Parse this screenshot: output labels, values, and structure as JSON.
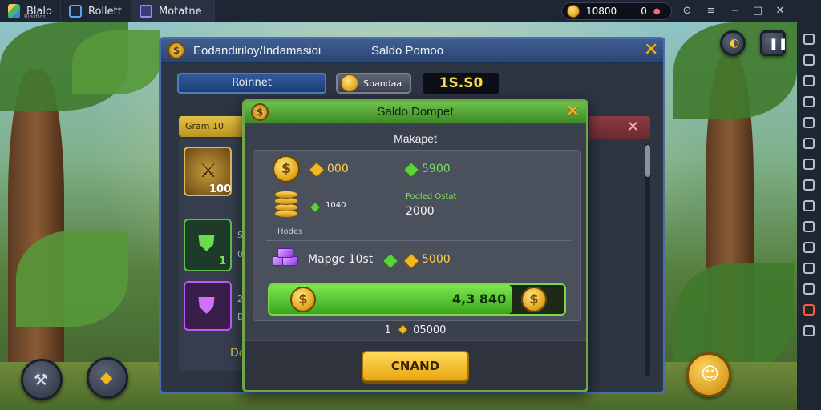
{
  "window": {
    "app_title": "Blalo",
    "app_subtitle": "Blastics",
    "tabs": [
      {
        "label": "Rollett",
        "icon": "app-icon"
      },
      {
        "label": "Motatne",
        "icon": "game-icon"
      }
    ],
    "coin_balance": "10800",
    "coin_secondary": "0",
    "controls": [
      "record-icon",
      "settings-icon",
      "menu-icon",
      "minimize-icon",
      "maximize-icon",
      "close-icon"
    ]
  },
  "sidebar": {
    "icons": [
      "expand-icon",
      "keyboard-icon",
      "volume-icon",
      "screen-icon",
      "camera-icon",
      "record-icon",
      "folder-icon",
      "multi-instance-icon",
      "location-icon",
      "shake-icon",
      "rotate-icon",
      "eco-icon",
      "more-icon",
      "settings-icon",
      "back-icon"
    ]
  },
  "back_panel": {
    "title": "Eodandiriloy/Indamasioi",
    "title2": "Saldo Pomoo",
    "tab_button": "Roinnet",
    "coin_button": "Spandaa",
    "amount": "1S.S0",
    "yellow_tab": "Gram 10",
    "gold_item_count": "100",
    "green_item_count": "1",
    "side_labels": [
      "S",
      "0",
      "2",
      "D"
    ],
    "bottom_label": "Do"
  },
  "dialog": {
    "title": "Saldo Dompet",
    "subtitle": "Makapet",
    "row1": {
      "gold_value": "000",
      "green_value": "5900"
    },
    "row2": {
      "label": "1040",
      "pending_label": "Pooled Ostat",
      "pending_value": "2000"
    },
    "section_label": "Hodes",
    "row3": {
      "label": "Mapgc 10st",
      "gold_value": "5000"
    },
    "progress": {
      "value": "4,3 840",
      "fill_fraction": 0.82
    },
    "footer_count": "1",
    "footer_value": "05000",
    "confirm_button": "CNAND"
  },
  "colors": {
    "accent_green": "#6cc24a",
    "accent_gold": "#ffd24a",
    "panel_blue": "#3f5e90",
    "danger_red": "#8c3a42"
  }
}
